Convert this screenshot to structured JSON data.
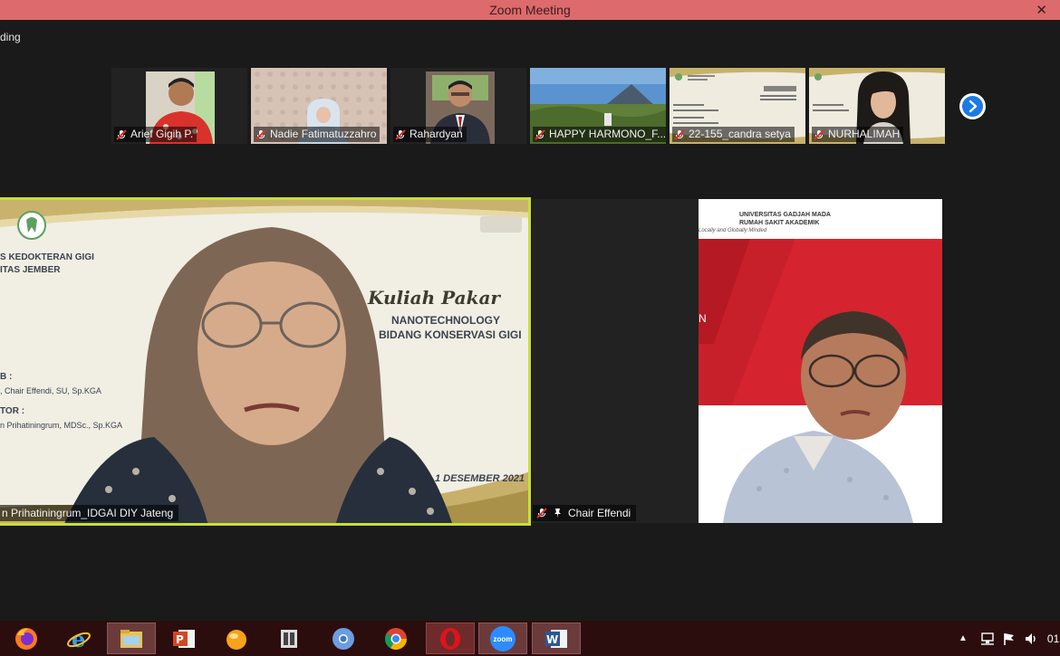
{
  "window": {
    "title": "Zoom Meeting",
    "close_glyph": "✕"
  },
  "recording": {
    "label": "ding"
  },
  "thumbnails": [
    {
      "name": "Arief Gigih P."
    },
    {
      "name": "Nadie Fatimatuzzahro"
    },
    {
      "name": "Rahardyan"
    },
    {
      "name": "HAPPY HARMONO_F..."
    },
    {
      "name": "22-155_candra setya"
    },
    {
      "name": "NURHALIMAH"
    }
  ],
  "main_speaker": {
    "caption": "n Prihatiningrum_IDGAI DIY Jateng",
    "slide": {
      "faculty_line1": "S KEDOKTERAN GIGI",
      "faculty_line2": "ITAS JEMBER",
      "script_title": "Kuliah Pakar",
      "topic_line1": "NANOTECHNOLOGY",
      "topic_line2": "BIDANG KONSERVASI GIGI",
      "speaker_label": "B :",
      "speaker_name": ", Chair Effendi, SU, Sp.KGA",
      "moderator_label": "TOR :",
      "moderator_name": "n Prihatiningrum, MDSc., Sp.KGA",
      "date": "1 DESEMBER 2021"
    }
  },
  "second_speaker": {
    "caption": "Chair Effendi",
    "background": {
      "line1": "UNIVERSITAS GADJAH MADA",
      "line2": "RUMAH SAKIT AKADEMIK",
      "line3": "Locally and Globally Minded",
      "side_text": "N"
    }
  },
  "colors": {
    "titlebar": "#dd6a6c",
    "active_border": "#c7df36",
    "taskbar": "#2c0d0d",
    "accent_blue": "#1d79e6"
  },
  "taskbar": {
    "items": [
      {
        "icon": "firefox-icon"
      },
      {
        "icon": "internet-explorer-icon"
      },
      {
        "icon": "file-explorer-icon"
      },
      {
        "icon": "powerpoint-icon"
      },
      {
        "icon": "orange-ball-icon"
      },
      {
        "icon": "media-icon"
      },
      {
        "icon": "chromium-icon"
      },
      {
        "icon": "chrome-icon"
      },
      {
        "icon": "opera-icon"
      },
      {
        "icon": "zoom-icon",
        "label": "zoom"
      },
      {
        "icon": "word-icon",
        "label": "W"
      }
    ],
    "tray": {
      "clock_partial": "01"
    }
  }
}
